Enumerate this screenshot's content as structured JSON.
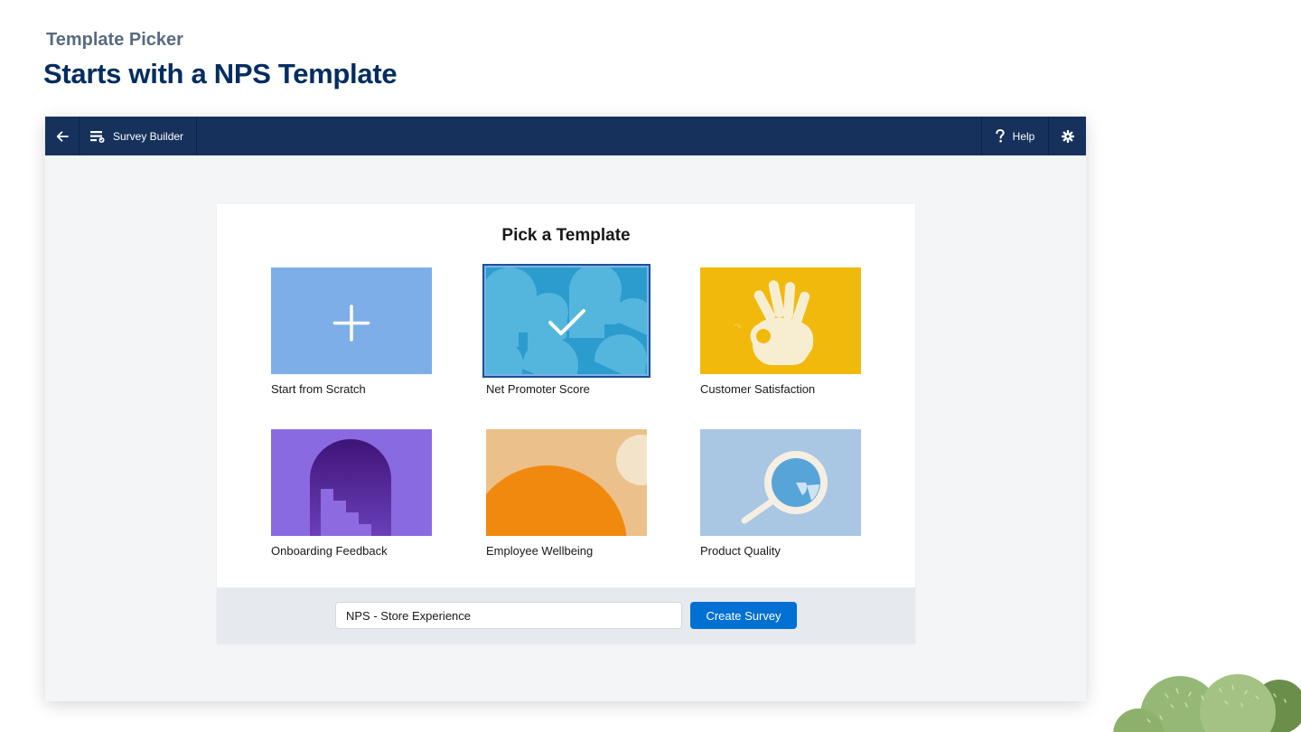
{
  "slide": {
    "eyebrow": "Template Picker",
    "headline": "Starts with a NPS Template"
  },
  "topbar": {
    "back_icon": "arrow-left-icon",
    "app_icon": "survey-builder-icon",
    "app_title": "Survey Builder",
    "help_icon": "question-icon",
    "help_label": "Help",
    "settings_icon": "gear-icon"
  },
  "picker": {
    "title": "Pick a Template",
    "templates": [
      {
        "label": "Start from Scratch",
        "color": "#7eaee7",
        "icon": "plus-icon",
        "selected": false
      },
      {
        "label": "Net Promoter Score",
        "color": "#2e9ecf",
        "icon": "checkmark-icon",
        "selected": true
      },
      {
        "label": "Customer Satisfaction",
        "color": "#f2b90d",
        "icon": "ok-hand-icon",
        "selected": false
      },
      {
        "label": "Onboarding Feedback",
        "color": "#8e6ae0",
        "icon": "arch-stairs-icon",
        "selected": false
      },
      {
        "label": "Employee Wellbeing",
        "color": "#ebc08a",
        "icon": "sun-icon",
        "selected": false
      },
      {
        "label": "Product Quality",
        "color": "#a9c6e2",
        "icon": "magnifier-icon",
        "selected": false
      }
    ]
  },
  "footer": {
    "survey_name_value": "NPS - Store Experience",
    "create_label": "Create Survey"
  },
  "colors": {
    "brand_navy": "#16325c",
    "primary_button": "#0070d2",
    "headline": "#032d60"
  }
}
